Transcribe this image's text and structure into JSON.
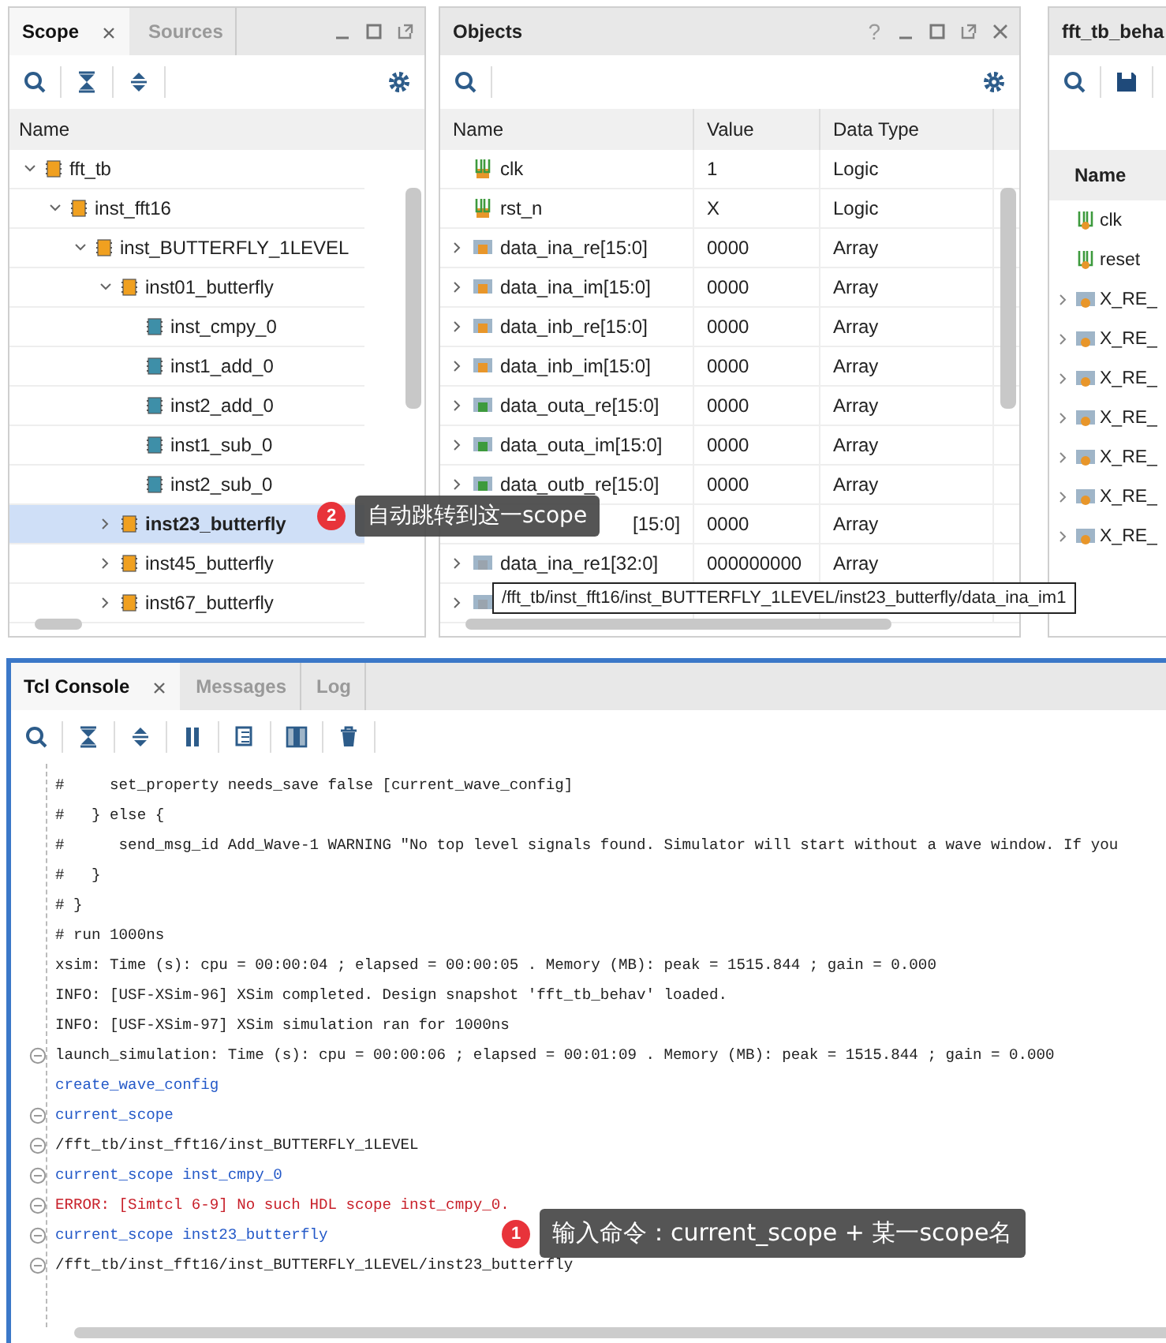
{
  "scope_panel": {
    "tabs": [
      {
        "label": "Scope",
        "selected": true,
        "closable": true
      },
      {
        "label": "Sources",
        "selected": false,
        "closable": false
      }
    ],
    "column": "Name",
    "tree": [
      {
        "name": "fft_tb",
        "kind": "module",
        "expanded": true,
        "selected": false,
        "children": [
          {
            "name": "inst_fft16",
            "kind": "module",
            "expanded": true,
            "selected": false,
            "children": [
              {
                "name": "inst_BUTTERFLY_1LEVEL",
                "kind": "module",
                "expanded": true,
                "selected": false,
                "children": [
                  {
                    "name": "inst01_butterfly",
                    "kind": "module",
                    "expanded": true,
                    "selected": false,
                    "children": [
                      {
                        "name": "inst_cmpy_0",
                        "kind": "leaf",
                        "selected": false
                      },
                      {
                        "name": "inst1_add_0",
                        "kind": "leaf",
                        "selected": false
                      },
                      {
                        "name": "inst2_add_0",
                        "kind": "leaf",
                        "selected": false
                      },
                      {
                        "name": "inst1_sub_0",
                        "kind": "leaf",
                        "selected": false
                      },
                      {
                        "name": "inst2_sub_0",
                        "kind": "leaf",
                        "selected": false
                      }
                    ]
                  },
                  {
                    "name": "inst23_butterfly",
                    "kind": "module",
                    "expanded": false,
                    "selected": true
                  },
                  {
                    "name": "inst45_butterfly",
                    "kind": "module",
                    "expanded": false,
                    "selected": false
                  },
                  {
                    "name": "inst67_butterfly",
                    "kind": "module",
                    "expanded": false,
                    "selected": false
                  }
                ]
              }
            ]
          }
        ]
      }
    ]
  },
  "objects_panel": {
    "title": "Objects",
    "help": "?",
    "columns": [
      "Name",
      "Value",
      "Data Type"
    ],
    "rows": [
      {
        "name": "clk",
        "value": "1",
        "data_type": "Logic",
        "kind": "input-bit"
      },
      {
        "name": "rst_n",
        "value": "X",
        "data_type": "Logic",
        "kind": "input-bit"
      },
      {
        "name": "data_ina_re[15:0]",
        "value": "0000",
        "data_type": "Array",
        "kind": "input-bus"
      },
      {
        "name": "data_ina_im[15:0]",
        "value": "0000",
        "data_type": "Array",
        "kind": "input-bus"
      },
      {
        "name": "data_inb_re[15:0]",
        "value": "0000",
        "data_type": "Array",
        "kind": "input-bus"
      },
      {
        "name": "data_inb_im[15:0]",
        "value": "0000",
        "data_type": "Array",
        "kind": "input-bus"
      },
      {
        "name": "data_outa_re[15:0]",
        "value": "0000",
        "data_type": "Array",
        "kind": "output-bus"
      },
      {
        "name": "data_outa_im[15:0]",
        "value": "0000",
        "data_type": "Array",
        "kind": "output-bus"
      },
      {
        "name": "data_outb_re[15:0]",
        "value": "0000",
        "data_type": "Array",
        "kind": "output-bus"
      },
      {
        "name": "[15:0]",
        "value": "0000",
        "data_type": "Array",
        "kind": "covered"
      },
      {
        "name": "data_ina_re1[32:0]",
        "value": "000000000",
        "data_type": "Array",
        "kind": "internal-bus"
      },
      {
        "kind": "hidden"
      }
    ],
    "tooltip": "/fft_tb/inst_fft16/inst_BUTTERFLY_1LEVEL/inst23_butterfly/data_ina_im1"
  },
  "wave_panel": {
    "title": "fft_tb_beha",
    "column": "Name",
    "rows": [
      {
        "name": "clk",
        "kind": "bit"
      },
      {
        "name": "reset",
        "kind": "bit"
      },
      {
        "name": "X_RE_",
        "kind": "bus"
      },
      {
        "name": "X_RE_",
        "kind": "bus"
      },
      {
        "name": "X_RE_",
        "kind": "bus"
      },
      {
        "name": "X_RE_",
        "kind": "bus"
      },
      {
        "name": "X_RE_",
        "kind": "bus"
      },
      {
        "name": "X_RE_",
        "kind": "bus"
      },
      {
        "name": "X_RE_",
        "kind": "bus"
      }
    ]
  },
  "console_panel": {
    "tabs": [
      {
        "label": "Tcl Console",
        "selected": true,
        "closable": true
      },
      {
        "label": "Messages",
        "selected": false,
        "closable": false
      },
      {
        "label": "Log",
        "selected": false,
        "closable": false
      }
    ],
    "lines": [
      {
        "text": "#     set_property needs_save false [current_wave_config]",
        "kind": "output",
        "fold": false
      },
      {
        "text": "#   } else {",
        "kind": "output",
        "fold": false
      },
      {
        "text": "#      send_msg_id Add_Wave-1 WARNING \"No top level signals found. Simulator will start without a wave window. If you",
        "kind": "output",
        "fold": false
      },
      {
        "text": "#   }",
        "kind": "output",
        "fold": false
      },
      {
        "text": "# }",
        "kind": "output",
        "fold": false
      },
      {
        "text": "# run 1000ns",
        "kind": "output",
        "fold": false
      },
      {
        "text": "xsim: Time (s): cpu = 00:00:04 ; elapsed = 00:00:05 . Memory (MB): peak = 1515.844 ; gain = 0.000",
        "kind": "output",
        "fold": false
      },
      {
        "text": "INFO: [USF-XSim-96] XSim completed. Design snapshot 'fft_tb_behav' loaded.",
        "kind": "output",
        "fold": false
      },
      {
        "text": "INFO: [USF-XSim-97] XSim simulation ran for 1000ns",
        "kind": "output",
        "fold": false
      },
      {
        "text": "launch_simulation: Time (s): cpu = 00:00:06 ; elapsed = 00:01:09 . Memory (MB): peak = 1515.844 ; gain = 0.000",
        "kind": "output",
        "fold": true
      },
      {
        "text": "create_wave_config",
        "kind": "command",
        "fold": false
      },
      {
        "text": "current_scope",
        "kind": "command",
        "fold": true
      },
      {
        "text": "/fft_tb/inst_fft16/inst_BUTTERFLY_1LEVEL",
        "kind": "output",
        "fold": true
      },
      {
        "text": "current_scope inst_cmpy_0",
        "kind": "command",
        "fold": true
      },
      {
        "text": "ERROR: [Simtcl 6-9] No such HDL scope inst_cmpy_0.",
        "kind": "error",
        "fold": true
      },
      {
        "text": "current_scope inst23_butterfly",
        "kind": "command",
        "fold": true
      },
      {
        "text": "/fft_tb/inst_fft16/inst_BUTTERFLY_1LEVEL/inst23_butterfly",
        "kind": "output",
        "fold": true
      }
    ]
  },
  "callouts": [
    {
      "number": "2",
      "text": "自动跳转到这一scope",
      "kind": "scope"
    },
    {
      "number": "1",
      "text": "输入命令：current_scope + 某一scope名",
      "kind": "console"
    }
  ]
}
